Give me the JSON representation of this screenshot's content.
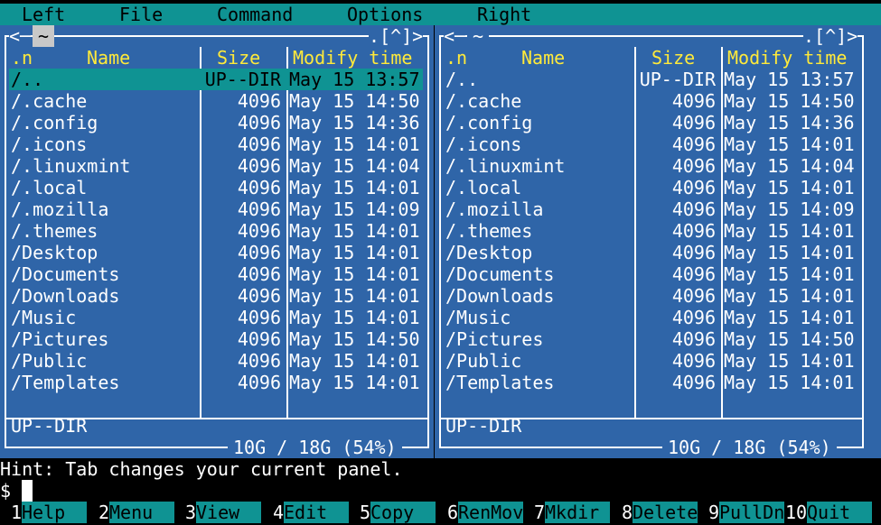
{
  "menu": {
    "left": "Left",
    "file": "File",
    "command": "Command",
    "options": "Options",
    "right": "Right"
  },
  "left_panel": {
    "path": "~",
    "corner": ".[^]>",
    "headers": {
      "name_sort": ".n",
      "name": "Name",
      "size": "Size",
      "mtime": "Modify time"
    },
    "rows": [
      {
        "name": "/..",
        "size": "UP--DIR",
        "mtime": "May 15 13:57"
      },
      {
        "name": "/.cache",
        "size": "4096",
        "mtime": "May 15 14:50"
      },
      {
        "name": "/.config",
        "size": "4096",
        "mtime": "May 15 14:36"
      },
      {
        "name": "/.icons",
        "size": "4096",
        "mtime": "May 15 14:01"
      },
      {
        "name": "/.linuxmint",
        "size": "4096",
        "mtime": "May 15 14:04"
      },
      {
        "name": "/.local",
        "size": "4096",
        "mtime": "May 15 14:01"
      },
      {
        "name": "/.mozilla",
        "size": "4096",
        "mtime": "May 15 14:09"
      },
      {
        "name": "/.themes",
        "size": "4096",
        "mtime": "May 15 14:01"
      },
      {
        "name": "/Desktop",
        "size": "4096",
        "mtime": "May 15 14:01"
      },
      {
        "name": "/Documents",
        "size": "4096",
        "mtime": "May 15 14:01"
      },
      {
        "name": "/Downloads",
        "size": "4096",
        "mtime": "May 15 14:01"
      },
      {
        "name": "/Music",
        "size": "4096",
        "mtime": "May 15 14:01"
      },
      {
        "name": "/Pictures",
        "size": "4096",
        "mtime": "May 15 14:50"
      },
      {
        "name": "/Public",
        "size": "4096",
        "mtime": "May 15 14:01"
      },
      {
        "name": "/Templates",
        "size": "4096",
        "mtime": "May 15 14:01"
      }
    ],
    "status": "UP--DIR",
    "disk": "10G / 18G (54%)"
  },
  "right_panel": {
    "path": "~",
    "corner": ".[^]>",
    "headers": {
      "name_sort": ".n",
      "name": "Name",
      "size": "Size",
      "mtime": "Modify time"
    },
    "rows": [
      {
        "name": "/..",
        "size": "UP--DIR",
        "mtime": "May 15 13:57"
      },
      {
        "name": "/.cache",
        "size": "4096",
        "mtime": "May 15 14:50"
      },
      {
        "name": "/.config",
        "size": "4096",
        "mtime": "May 15 14:36"
      },
      {
        "name": "/.icons",
        "size": "4096",
        "mtime": "May 15 14:01"
      },
      {
        "name": "/.linuxmint",
        "size": "4096",
        "mtime": "May 15 14:04"
      },
      {
        "name": "/.local",
        "size": "4096",
        "mtime": "May 15 14:01"
      },
      {
        "name": "/.mozilla",
        "size": "4096",
        "mtime": "May 15 14:09"
      },
      {
        "name": "/.themes",
        "size": "4096",
        "mtime": "May 15 14:01"
      },
      {
        "name": "/Desktop",
        "size": "4096",
        "mtime": "May 15 14:01"
      },
      {
        "name": "/Documents",
        "size": "4096",
        "mtime": "May 15 14:01"
      },
      {
        "name": "/Downloads",
        "size": "4096",
        "mtime": "May 15 14:01"
      },
      {
        "name": "/Music",
        "size": "4096",
        "mtime": "May 15 14:01"
      },
      {
        "name": "/Pictures",
        "size": "4096",
        "mtime": "May 15 14:50"
      },
      {
        "name": "/Public",
        "size": "4096",
        "mtime": "May 15 14:01"
      },
      {
        "name": "/Templates",
        "size": "4096",
        "mtime": "May 15 14:01"
      }
    ],
    "status": "UP--DIR",
    "disk": "10G / 18G (54%)"
  },
  "hint": "Hint: Tab changes your current panel.",
  "prompt": "$",
  "fkeys": [
    {
      "num": "1",
      "label": "Help"
    },
    {
      "num": "2",
      "label": "Menu"
    },
    {
      "num": "3",
      "label": "View"
    },
    {
      "num": "4",
      "label": "Edit"
    },
    {
      "num": "5",
      "label": "Copy"
    },
    {
      "num": "6",
      "label": "RenMov"
    },
    {
      "num": "7",
      "label": "Mkdir"
    },
    {
      "num": "8",
      "label": "Delete"
    },
    {
      "num": "9",
      "label": "PullDn"
    },
    {
      "num": "10",
      "label": "Quit"
    }
  ],
  "colors": {
    "panel_bg": "#2f65a8",
    "accent": "#0f9393",
    "header": "#ffea3a"
  }
}
